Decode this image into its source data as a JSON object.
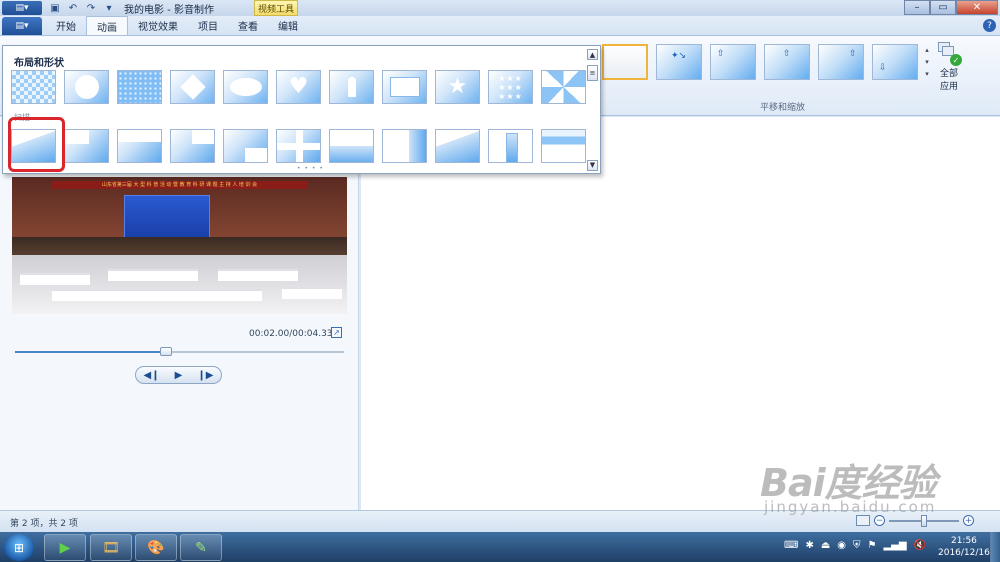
{
  "titlebar": {
    "app_button": "▤▾",
    "title": "我的电影 - 影音制作",
    "context_tab": "视频工具",
    "quick_icons": [
      "save-icon",
      "undo-icon",
      "redo-icon",
      "customize-icon"
    ]
  },
  "tabs": {
    "items": [
      "开始",
      "动画",
      "视觉效果",
      "项目",
      "查看",
      "编辑"
    ],
    "active": "动画"
  },
  "ribbon": {
    "pan_group_label": "平移和缩放",
    "apply_all_label": "全部应用"
  },
  "gallery": {
    "section1_title": "布局和形状",
    "section2_title": "扫描",
    "row1_tiles": [
      "checker",
      "circle",
      "dots",
      "diamond",
      "ellipse",
      "heart",
      "keyhole",
      "rectangle",
      "star",
      "stars",
      "fan"
    ],
    "row2_tiles": [
      "skew",
      "white-tl",
      "white-top",
      "white-tr",
      "white-br",
      "cross",
      "band",
      "vband",
      "diag",
      "pillar",
      "stripe"
    ],
    "selected_tile": "skew"
  },
  "preview": {
    "time": "00:02.00/00:04.33",
    "progress": 0.46,
    "banner_text": "山东省第三届 大 型 科 普 活 动 暨 教 育 科 研 课 题 主 持 人 培 训 会"
  },
  "status": {
    "text": "第 2 项，共 2 项",
    "zoom": 0.5
  },
  "taskbar": {
    "time": "21:56",
    "date": "2016/12/16"
  },
  "watermark": {
    "logo": "Bai度经验",
    "url": "jingyan.baidu.com"
  },
  "colors": {
    "accent": "#2c63b4",
    "selection_ring": "#d8262c",
    "context_tab": "#f3dd69"
  }
}
